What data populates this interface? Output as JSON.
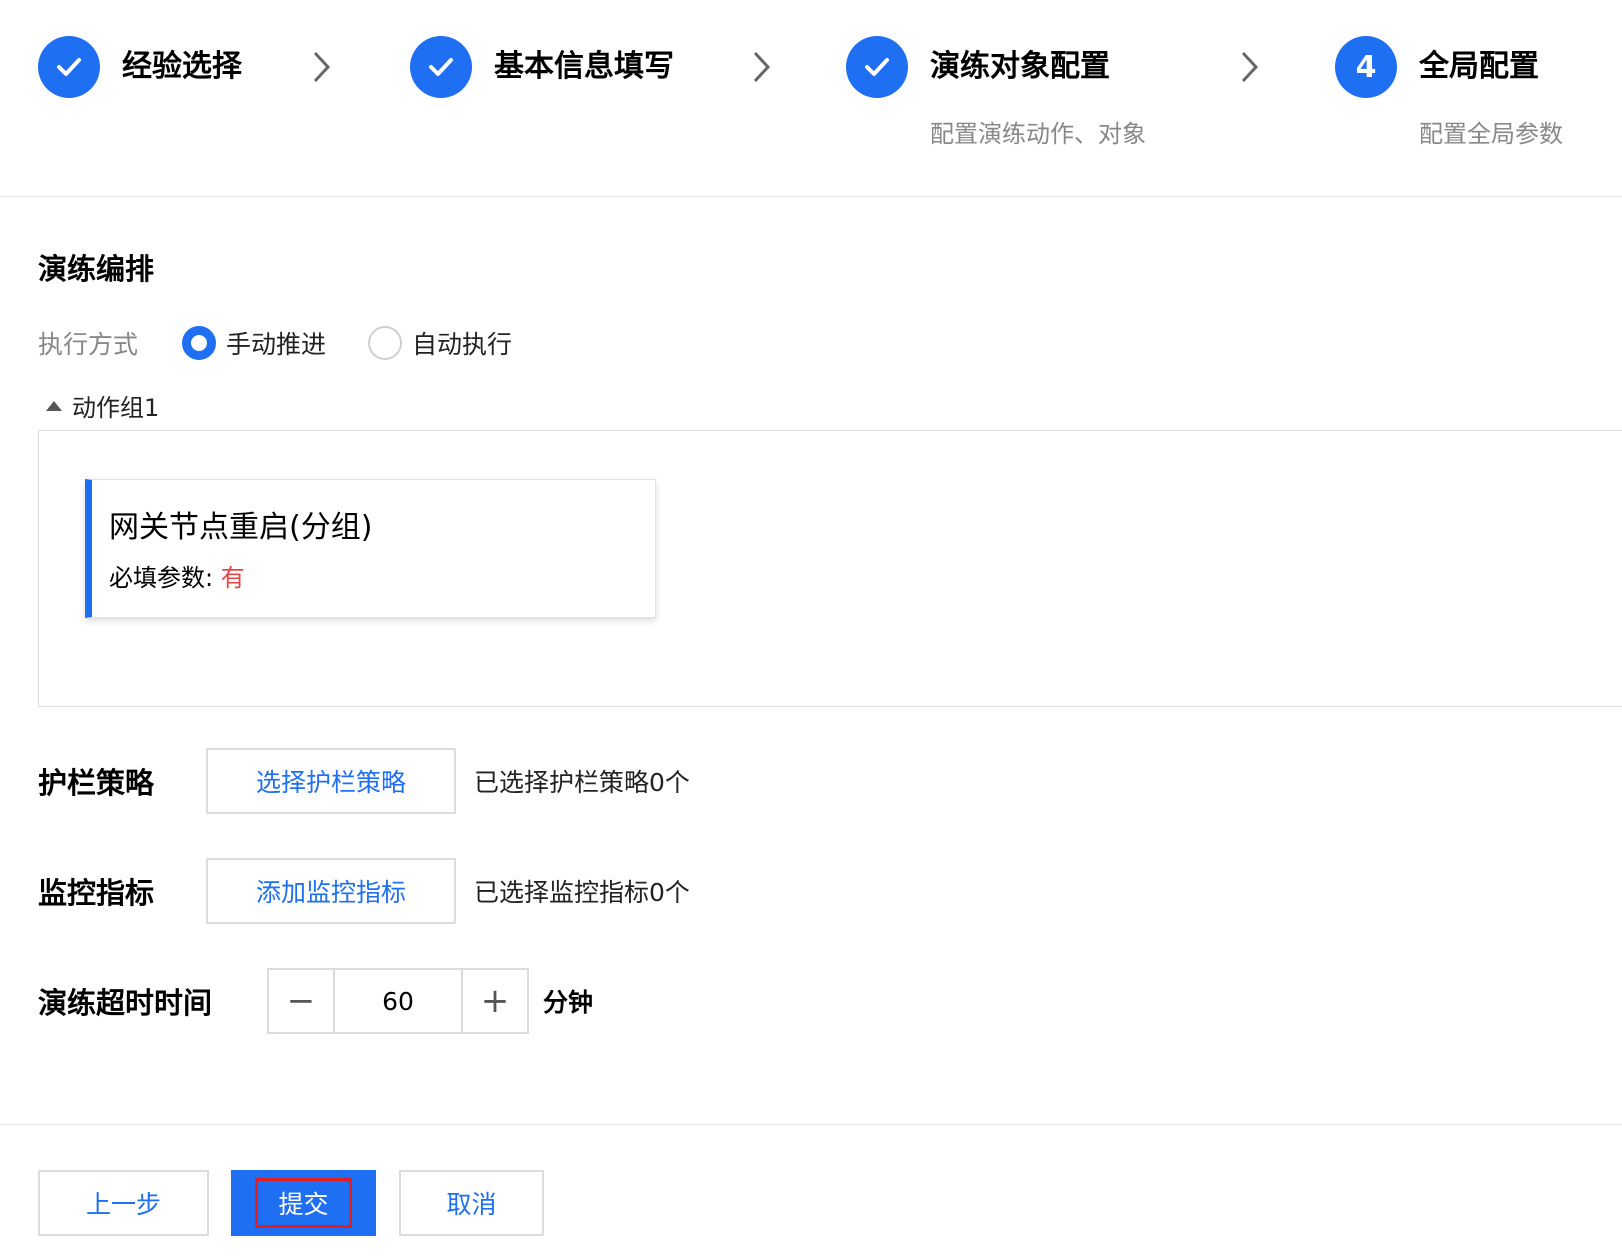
{
  "steps": [
    {
      "title": "经验选择",
      "status": "done",
      "icon": "check-icon"
    },
    {
      "title": "基本信息填写",
      "status": "done",
      "icon": "check-icon"
    },
    {
      "title": "演练对象配置",
      "status": "done",
      "icon": "check-icon",
      "desc": "配置演练动作、对象"
    },
    {
      "title": "全局配置",
      "status": "current",
      "number": "4",
      "desc": "配置全局参数"
    }
  ],
  "section": {
    "title": "演练编排"
  },
  "exec_mode": {
    "label": "执行方式",
    "options": [
      {
        "label": "手动推进",
        "selected": true
      },
      {
        "label": "自动执行",
        "selected": false
      }
    ]
  },
  "action_group": {
    "label": "动作组1",
    "card": {
      "title": "网关节点重启(分组)",
      "param_label": "必填参数:",
      "param_value": "有"
    }
  },
  "guardrail": {
    "label": "护栏策略",
    "button": "选择护栏策略",
    "note": "已选择护栏策略0个"
  },
  "monitor": {
    "label": "监控指标",
    "button": "添加监控指标",
    "note": "已选择监控指标0个"
  },
  "timeout": {
    "label": "演练超时时间",
    "value": "60",
    "unit": "分钟",
    "minus": "−",
    "plus": "+"
  },
  "footer": {
    "prev": "上一步",
    "submit": "提交",
    "cancel": "取消"
  },
  "colors": {
    "primary": "#1f6ff2",
    "danger": "#e54545",
    "highlight": "#e02020"
  }
}
